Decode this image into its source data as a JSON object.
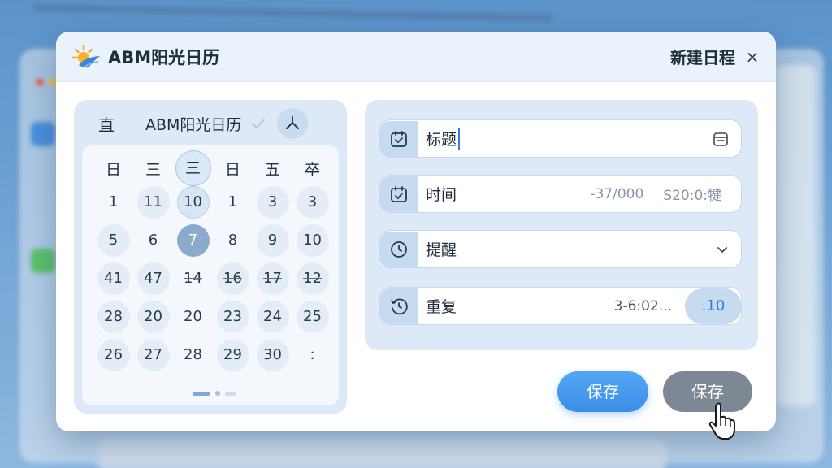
{
  "app": {
    "title": "ABM阳光日历"
  },
  "dialog": {
    "title": "新建日程",
    "close_icon": "×"
  },
  "calendar": {
    "header_char": "直",
    "header_title": "ABM阳光日历",
    "weekdays": [
      "日",
      "三",
      "三",
      "日",
      "五",
      "卒"
    ],
    "days": [
      [
        "1",
        "11",
        "10",
        "1",
        "3",
        "3"
      ],
      [
        "5",
        "6",
        "7",
        "8",
        "9",
        "10"
      ],
      [
        "41",
        "47",
        "14",
        "16",
        "17",
        "12"
      ],
      [
        "28",
        "20",
        "20",
        "23",
        "24",
        "25"
      ],
      [
        "26",
        "27",
        "28",
        "29",
        "30",
        ":"
      ]
    ]
  },
  "form": {
    "title_label": "标题",
    "time_label": "时间",
    "time_value_a": "-37/000",
    "time_value_b": "S20:0:犍",
    "reminder_label": "提醒",
    "repeat_label": "重复",
    "repeat_value": "3-6:02...",
    "repeat_pill": ".10"
  },
  "buttons": {
    "save_primary": "保存",
    "save_secondary": "保存"
  },
  "colors": {
    "accent": "#3b8ee6",
    "panel": "#dde9f6",
    "today": "#8aabcb"
  }
}
